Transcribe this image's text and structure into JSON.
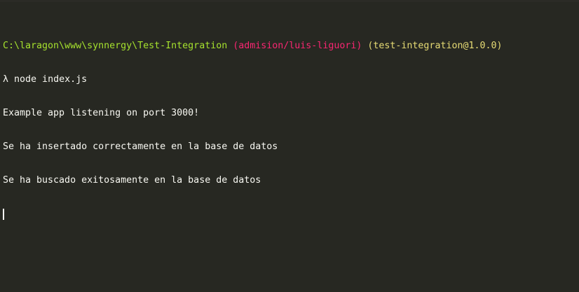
{
  "prompt": {
    "path": "C:\\laragon\\www\\synnergy\\Test-Integration",
    "branch": "(admision/luis-liguori)",
    "package": "(test-integration@1.0.0)"
  },
  "command": {
    "prompt_symbol": "λ",
    "text": "node index.js"
  },
  "output": [
    "Example app listening on port 3000!",
    "Se ha insertado correctamente en la base de datos",
    "Se ha buscado exitosamente en la base de datos"
  ],
  "colors": {
    "background": "#272822",
    "path": "#a6e22e",
    "branch": "#f92672",
    "package": "#e6db74",
    "text": "#f8f8f2"
  }
}
